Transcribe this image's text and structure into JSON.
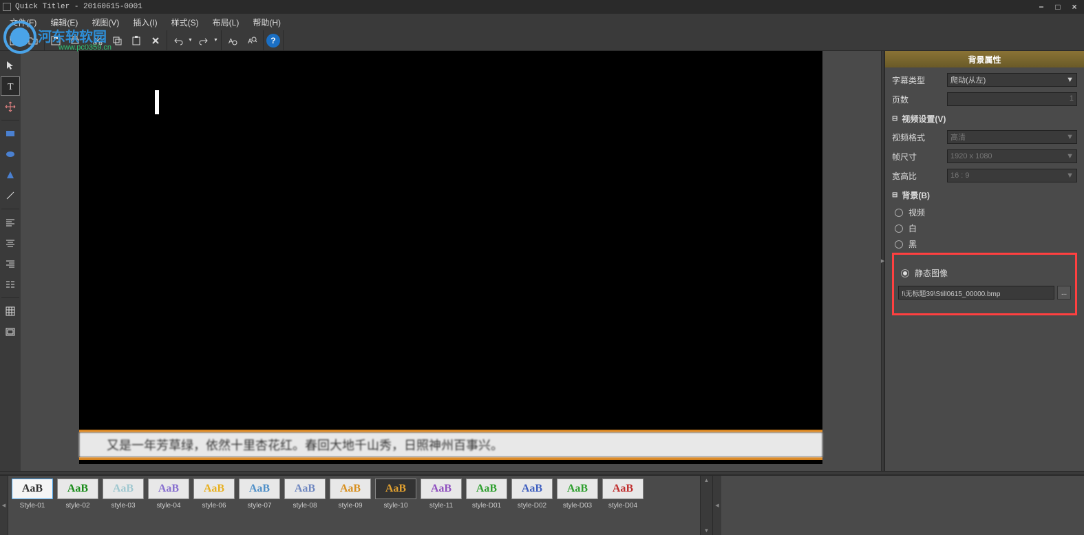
{
  "title": "Quick Titler - 20160615-0001",
  "watermark": {
    "text": "河东软软园",
    "url": "www.pc0359.cn"
  },
  "menu": [
    "文件(F)",
    "编辑(E)",
    "视图(V)",
    "插入(I)",
    "样式(S)",
    "布局(L)",
    "帮助(H)"
  ],
  "lower_third_text": "又是一年芳草绿，依然十里杏花红。春回大地千山秀，日照神州百事兴。",
  "right_panel": {
    "title": "背景属性",
    "subtitle_type_label": "字幕类型",
    "subtitle_type_value": "爬动(从左)",
    "page_count_label": "页数",
    "page_count_value": "1",
    "video_section": "视频设置(V)",
    "video_format_label": "视频格式",
    "video_format_value": "高清",
    "frame_size_label": "帧尺寸",
    "frame_size_value": "1920 x 1080",
    "aspect_label": "宽高比",
    "aspect_value": "16 : 9",
    "bg_section": "背景(B)",
    "bg_video": "视频",
    "bg_white": "白",
    "bg_black": "黑",
    "bg_still": "静态图像",
    "bg_path": "!\\无标题39\\Still0615_00000.bmp",
    "browse": "..."
  },
  "styles": [
    {
      "name": "Style-01",
      "txt": "AaB",
      "color": "#333",
      "bg": "#f5f5f5",
      "sel": true
    },
    {
      "name": "style-02",
      "txt": "AaB",
      "color": "#1a8c1a",
      "bg": "#e8e8e8"
    },
    {
      "name": "style-03",
      "txt": "AaB",
      "color": "#a0c8d0",
      "bg": "#e8e8e8"
    },
    {
      "name": "style-04",
      "txt": "AaB",
      "color": "#8870d0",
      "bg": "#e8e8e8"
    },
    {
      "name": "style-06",
      "txt": "AaB",
      "color": "#e8b020",
      "bg": "#e8e8e8"
    },
    {
      "name": "style-07",
      "txt": "AaB",
      "color": "#5090c8",
      "bg": "#e8e8e8"
    },
    {
      "name": "style-08",
      "txt": "AaB",
      "color": "#7088c0",
      "bg": "#e8e8e8"
    },
    {
      "name": "style-09",
      "txt": "AaB",
      "color": "#d89020",
      "bg": "#e8e8e8"
    },
    {
      "name": "style-10",
      "txt": "AaB",
      "color": "#e0a030",
      "bg": "#333"
    },
    {
      "name": "style-11",
      "txt": "AaB",
      "color": "#9050c0",
      "bg": "#e8e8e8"
    },
    {
      "name": "style-D01",
      "txt": "AaB",
      "color": "#30a030",
      "bg": "#e8e8e8"
    },
    {
      "name": "style-D02",
      "txt": "AaB",
      "color": "#4060c0",
      "bg": "#e8e8e8"
    },
    {
      "name": "style-D03",
      "txt": "AaB",
      "color": "#30a030",
      "bg": "#e8e8e8"
    },
    {
      "name": "style-D04",
      "txt": "AaB",
      "color": "#c03030",
      "bg": "#e8e8e8"
    }
  ]
}
